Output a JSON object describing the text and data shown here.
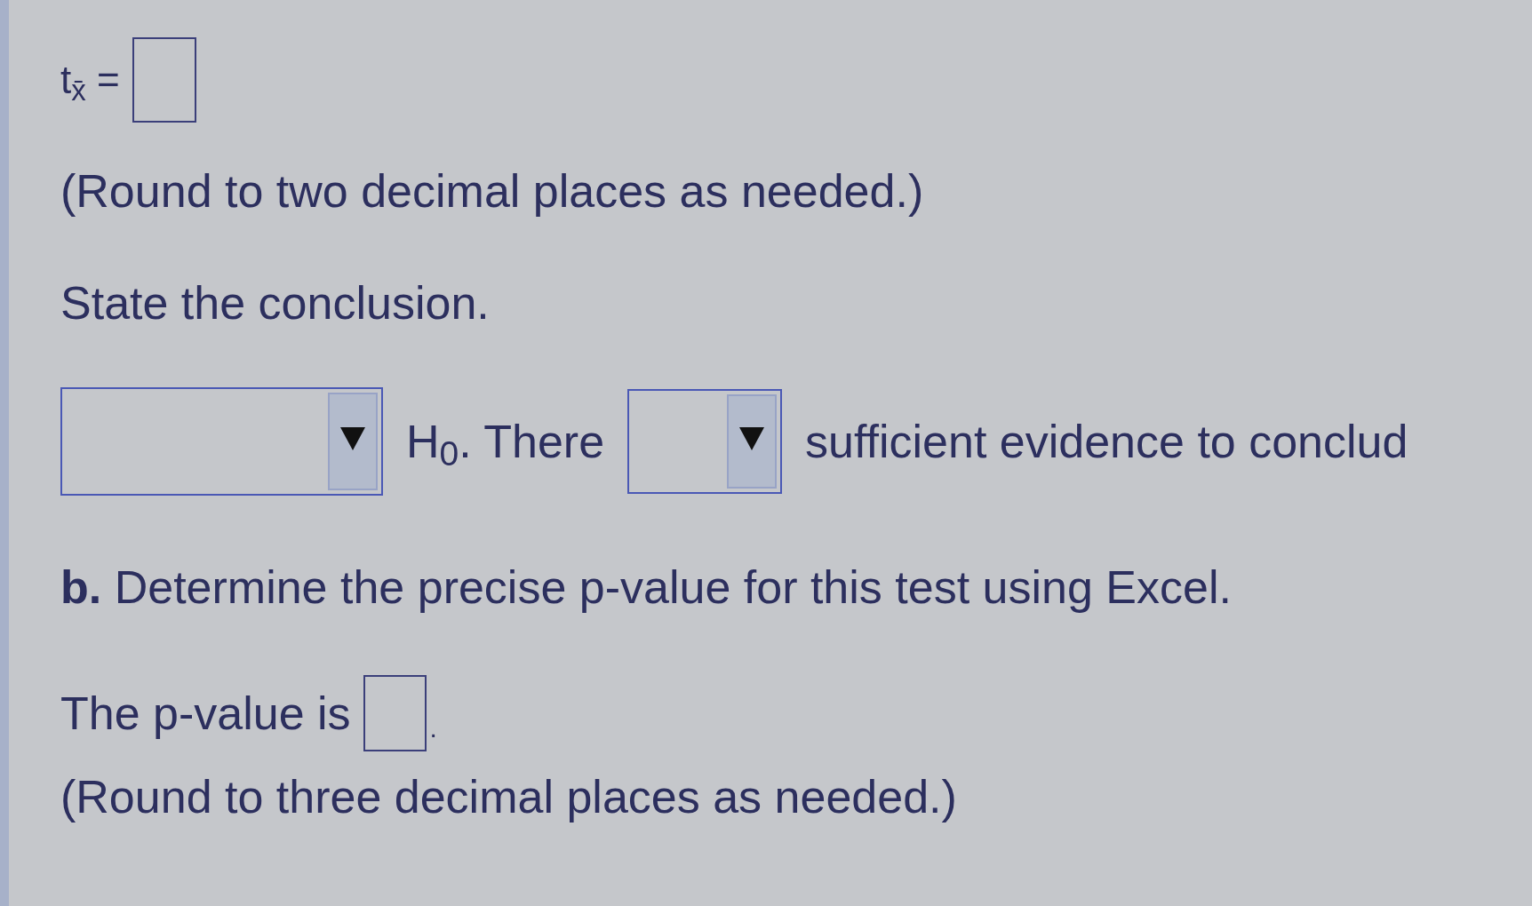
{
  "equation": {
    "label": "t$_{x̄}$ ="
  },
  "equation_note": "(Round to two decimal places as needed.)",
  "conclusion": {
    "prompt": "State the conclusion.",
    "parts": [
      {
        "kind": "dropdown"
      },
      {
        "kind": "text",
        "text": "H$_{0}$. There"
      },
      {
        "kind": "dropdown"
      },
      {
        "kind": "text",
        "text": "sufficient evidence to conclud"
      }
    ]
  },
  "part_b": {
    "question": "**b.** Determine the precise p-value for this test using Excel.",
    "answer_label": "The p-value is",
    "answer_suffix": ".",
    "note": "(Round to three decimal places as needed.)"
  }
}
